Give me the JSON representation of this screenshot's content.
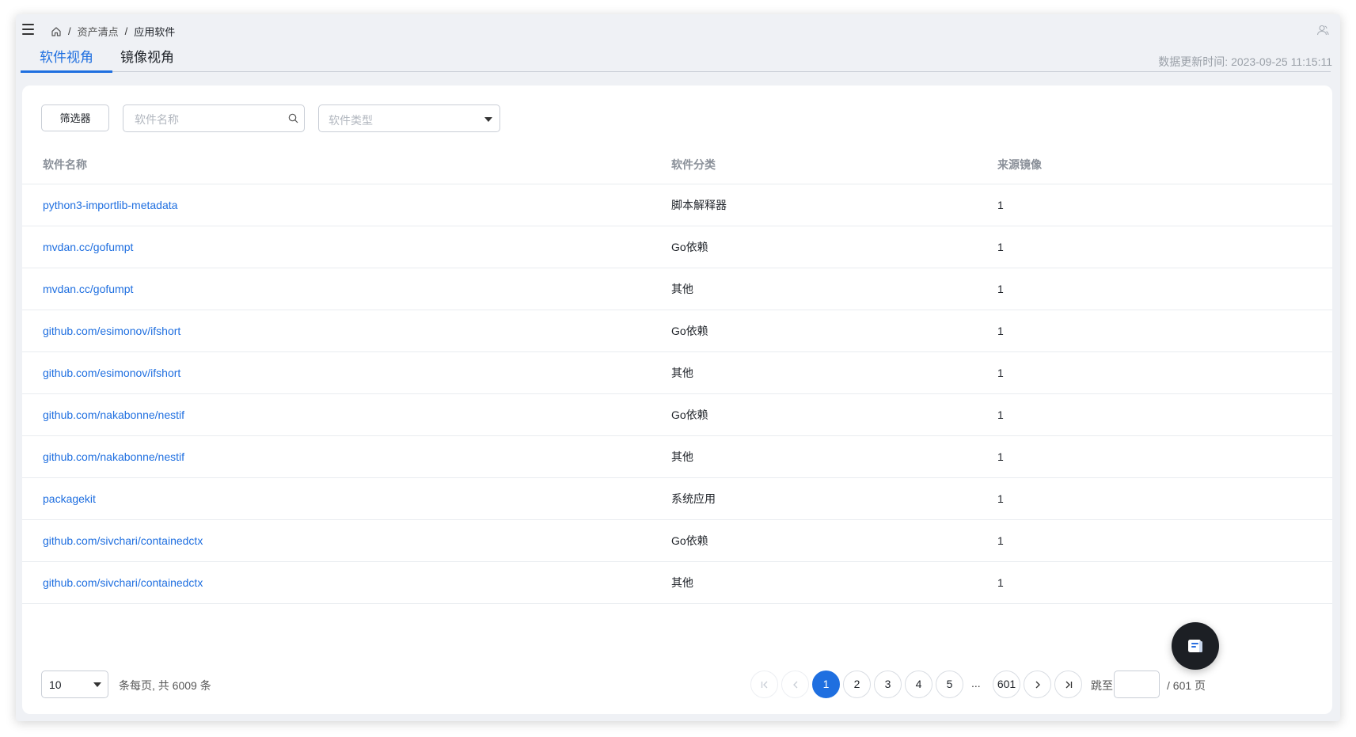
{
  "breadcrumb": {
    "items": [
      "资产清点",
      "应用软件"
    ]
  },
  "tabs": [
    "软件视角",
    "镜像视角"
  ],
  "update_time": "数据更新时间: 2023-09-25 11:15:11",
  "toolbar": {
    "filter_label": "筛选器",
    "search_placeholder": "软件名称",
    "type_placeholder": "软件类型"
  },
  "table": {
    "headers": [
      "软件名称",
      "软件分类",
      "来源镜像"
    ],
    "rows": [
      [
        "python3-importlib-metadata",
        "脚本解释器",
        "1"
      ],
      [
        "mvdan.cc/gofumpt",
        "Go依赖",
        "1"
      ],
      [
        "mvdan.cc/gofumpt",
        "其他",
        "1"
      ],
      [
        "github.com/esimonov/ifshort",
        "Go依赖",
        "1"
      ],
      [
        "github.com/esimonov/ifshort",
        "其他",
        "1"
      ],
      [
        "github.com/nakabonne/nestif",
        "Go依赖",
        "1"
      ],
      [
        "github.com/nakabonne/nestif",
        "其他",
        "1"
      ],
      [
        "packagekit",
        "系统应用",
        "1"
      ],
      [
        "github.com/sivchari/containedctx",
        "Go依赖",
        "1"
      ],
      [
        "github.com/sivchari/containedctx",
        "其他",
        "1"
      ]
    ]
  },
  "pagination": {
    "page_size": "10",
    "summary": "条每页, 共 6009 条",
    "pages": [
      "1",
      "2",
      "3",
      "4",
      "5"
    ],
    "ellipsis": "...",
    "last_page": "601",
    "current": "1",
    "jump_label": "跳至",
    "total_pages_label": "/ 601 页"
  },
  "colors": {
    "accent": "#1f6fe0",
    "muted": "#8a9099",
    "fab": "#1c1f24"
  },
  "icons": [
    "menu-icon",
    "home-icon",
    "user-icon",
    "search-icon",
    "chevron-down-icon",
    "first-page-icon",
    "prev-page-icon",
    "next-page-icon",
    "last-page-icon",
    "document-icon"
  ]
}
